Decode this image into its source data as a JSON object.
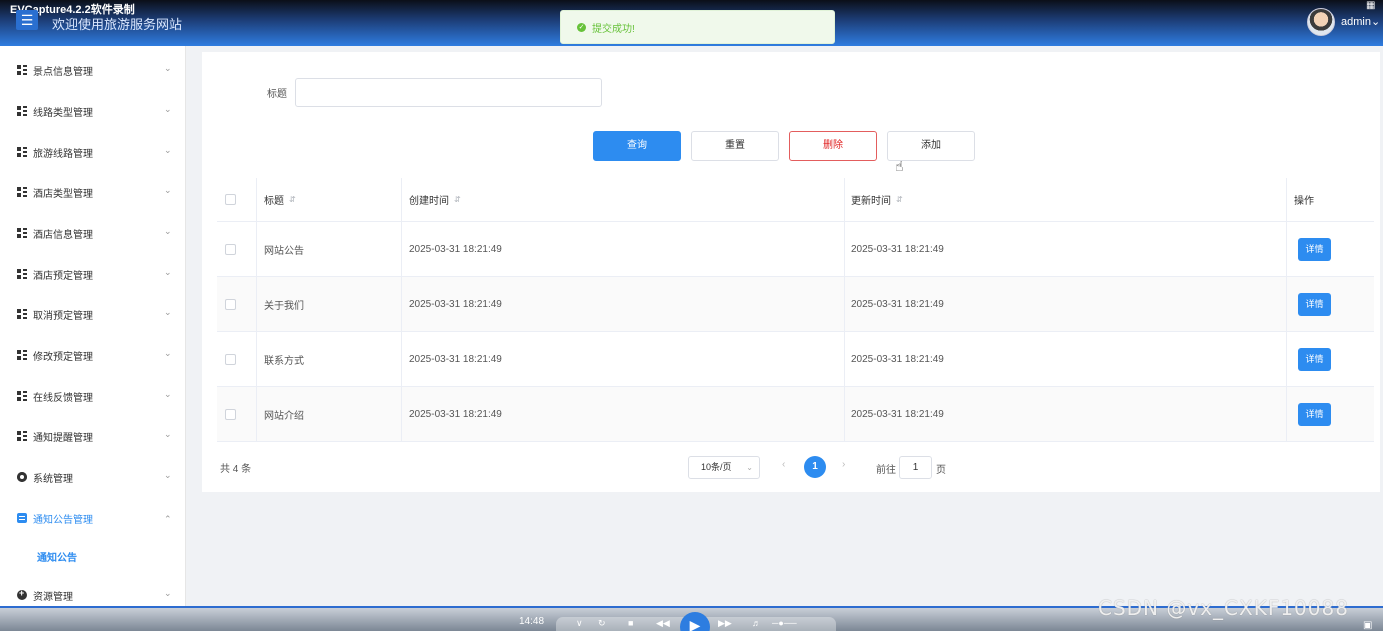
{
  "app": {
    "recorder_title": "EVCapture4.2.2软件录制",
    "site_title": "欢迎使用旅游服务网站",
    "menu_icon": "hamburger-icon",
    "user": "admin",
    "corner_icon": "grid-icon"
  },
  "toast": {
    "message": "提交成功!",
    "type": "success"
  },
  "sidebar": {
    "items": [
      {
        "label": "景点信息管理",
        "icon": "grid-icon",
        "expanded": false
      },
      {
        "label": "线路类型管理",
        "icon": "grid-icon",
        "expanded": false
      },
      {
        "label": "旅游线路管理",
        "icon": "grid-icon",
        "expanded": false
      },
      {
        "label": "酒店类型管理",
        "icon": "grid-icon",
        "expanded": false
      },
      {
        "label": "酒店信息管理",
        "icon": "grid-icon",
        "expanded": false
      },
      {
        "label": "酒店预定管理",
        "icon": "grid-icon",
        "expanded": false
      },
      {
        "label": "取消预定管理",
        "icon": "grid-icon",
        "expanded": false
      },
      {
        "label": "修改预定管理",
        "icon": "grid-icon",
        "expanded": false
      },
      {
        "label": "在线反馈管理",
        "icon": "grid-icon",
        "expanded": false
      },
      {
        "label": "通知提醒管理",
        "icon": "grid-icon",
        "expanded": false
      },
      {
        "label": "系统管理",
        "icon": "gear-icon",
        "expanded": false
      },
      {
        "label": "通知公告管理",
        "icon": "document-icon",
        "expanded": true
      },
      {
        "label": "资源管理",
        "icon": "plus-circle-icon",
        "expanded": false
      }
    ],
    "active_subitem": "通知公告"
  },
  "search": {
    "label": "标题",
    "value": "",
    "placeholder": ""
  },
  "buttons": {
    "query": "查询",
    "reset": "重置",
    "delete": "删除",
    "add": "添加"
  },
  "table": {
    "headers": {
      "title": "标题",
      "created": "创建时间",
      "updated": "更新时间",
      "actions": "操作"
    },
    "rows": [
      {
        "title": "网站公告",
        "created": "2025-03-31 18:21:49",
        "updated": "2025-03-31 18:21:49",
        "action": "详情"
      },
      {
        "title": "关于我们",
        "created": "2025-03-31 18:21:49",
        "updated": "2025-03-31 18:21:49",
        "action": "详情"
      },
      {
        "title": "联系方式",
        "created": "2025-03-31 18:21:49",
        "updated": "2025-03-31 18:21:49",
        "action": "详情"
      },
      {
        "title": "网站介绍",
        "created": "2025-03-31 18:21:49",
        "updated": "2025-03-31 18:21:49",
        "action": "详情"
      }
    ]
  },
  "pagination": {
    "total_text": "共 4 条",
    "page_size": "10条/页",
    "current_page": "1",
    "goto_label": "前往",
    "goto_value": "1",
    "goto_suffix": "页"
  },
  "player": {
    "time": "14:48",
    "watermark": "CSDN @vx_CXKF10088"
  }
}
